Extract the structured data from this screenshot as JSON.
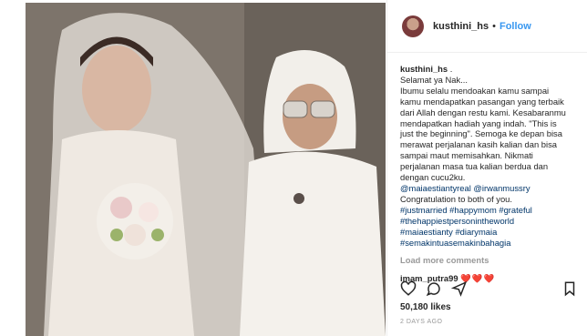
{
  "post": {
    "image_alt_name": "wedding-photo"
  },
  "header": {
    "username": "kusthini_hs",
    "separator": "•",
    "follow_label": "Follow"
  },
  "caption": {
    "username": "kusthini_hs",
    "lines": [
      " .",
      "Selamat ya Nak...",
      "Ibumu selalu mendoakan kamu sampai",
      "kamu mendapatkan pasangan yang terbaik",
      "dari Allah dengan restu kami. Kesabaranmu",
      "mendapatkan hadiah yang indah. \"This is",
      "just the beginning\". Semoga ke depan bisa",
      "merawat perjalanan kasih kalian dan bisa",
      "sampai maut memisahkan. Nikmati",
      "perjalanan masa tua kalian berdua dan",
      "dengan cucu2ku."
    ],
    "mentions": "@maiaestiantyreal @irwanmussry",
    "congrats": "Congratulation to both of you.",
    "hashtags": [
      "#justmarried #happymom #grateful",
      "#thehappiestpersonintheworld",
      "#maiaestianty #diarymaia",
      "#semakintuasemakinbahagia"
    ]
  },
  "load_more": "Load more comments",
  "comment": {
    "username": "imam_putra99",
    "text": "❤️❤️❤️"
  },
  "actions": {
    "like_icon": "heart-icon",
    "comment_icon": "comment-icon",
    "share_icon": "share-icon",
    "save_icon": "bookmark-icon"
  },
  "likes": "50,180 likes",
  "timestamp": "2 DAYS AGO",
  "colors": {
    "link": "#003569",
    "follow": "#3897f0",
    "meta": "#999999"
  }
}
